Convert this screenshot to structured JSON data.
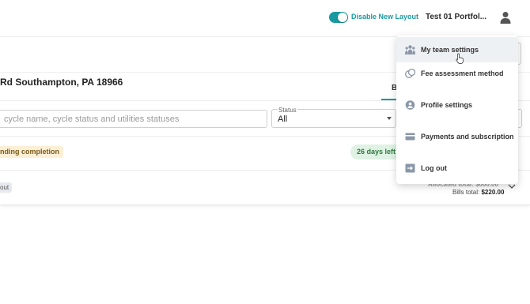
{
  "header": {
    "toggle_label": "Disable New Layout",
    "portfolio_name": "Test 01 Portfol...",
    "icons": {
      "user": "user-icon"
    }
  },
  "property": {
    "address": "Rd Southampton, PA 18966",
    "tab_label": "B"
  },
  "filters": {
    "search_placeholder": "cycle name, cycle status and utilities statuses",
    "status_label": "Status",
    "status_value": "All"
  },
  "rows": [
    {
      "status_badge": "nding completion",
      "days_badge": "26 days left"
    },
    {
      "status_badge": "out",
      "allocated_text": "Allocated total: $000.00",
      "bills_label": "Bills total:",
      "bills_value": "$220.00"
    }
  ],
  "menu": {
    "items": [
      {
        "label": "My team settings",
        "icon": "team-icon",
        "active": true
      },
      {
        "label": "Fee assessment method",
        "icon": "coins-icon"
      },
      {
        "label": "Profile settings",
        "icon": "profile-icon"
      },
      {
        "label": "Payments and subscription",
        "icon": "card-icon"
      },
      {
        "label": "Log out",
        "icon": "logout-icon"
      }
    ]
  },
  "colors": {
    "accent": "#1a9aa0",
    "pending_badge_bg": "#fbefd6",
    "days_badge_bg": "#dff2e4",
    "menu_active_bg": "#eef1f4"
  }
}
